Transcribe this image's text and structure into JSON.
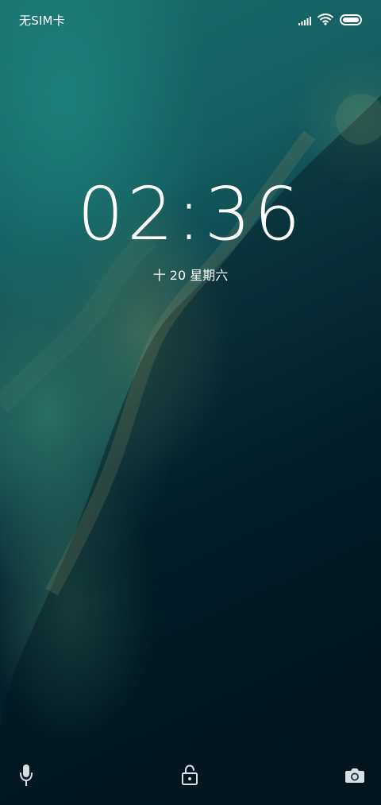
{
  "status_bar": {
    "carrier": "无SIM卡",
    "icons": [
      "signal-icon",
      "wifi-icon",
      "battery-icon"
    ]
  },
  "lockscreen": {
    "time": "02:36",
    "date": "十 20  星期六"
  },
  "bottom_actions": {
    "left_icon": "microphone-icon",
    "center_icon": "unlock-icon",
    "right_icon": "camera-icon"
  }
}
